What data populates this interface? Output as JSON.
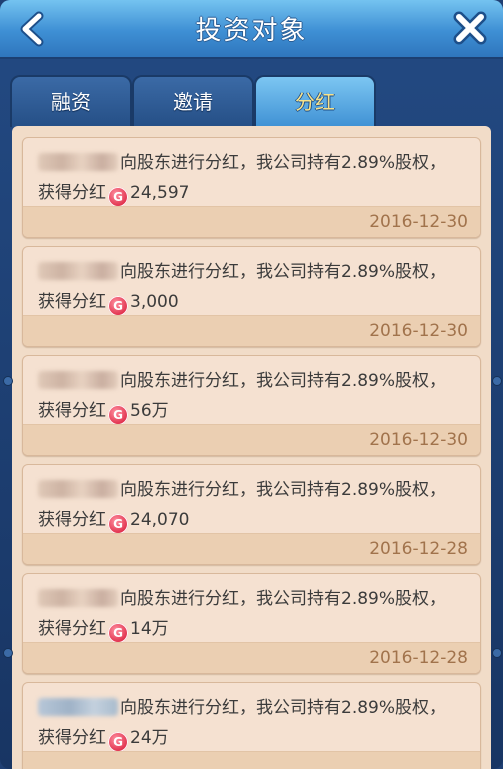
{
  "header": {
    "title": "投资对象",
    "back_icon": "chevron-left-icon",
    "close_icon": "close-icon"
  },
  "tabs": [
    {
      "label": "融资",
      "active": false
    },
    {
      "label": "邀请",
      "active": false
    },
    {
      "label": "分红",
      "active": true
    }
  ],
  "dividends": [
    {
      "message": "向股东进行分红，我公司持有2.89%股权，",
      "gain_label": "获得分红",
      "amount": "24,597",
      "date": "2016-12-30"
    },
    {
      "message": "向股东进行分红，我公司持有2.89%股权，",
      "gain_label": "获得分红",
      "amount": "3,000",
      "date": "2016-12-30"
    },
    {
      "message": "向股东进行分红，我公司持有2.89%股权，",
      "gain_label": "获得分红",
      "amount": "56万",
      "date": "2016-12-30"
    },
    {
      "message": "向股东进行分红，我公司持有2.89%股权，",
      "gain_label": "获得分红",
      "amount": "24,070",
      "date": "2016-12-28"
    },
    {
      "message": "向股东进行分红，我公司持有2.89%股权，",
      "gain_label": "获得分红",
      "amount": "14万",
      "date": "2016-12-28"
    },
    {
      "message": "向股东进行分红，我公司持有2.89%股权，",
      "gain_label": "获得分红",
      "amount": "24万",
      "date": ""
    }
  ],
  "coin_icon": "gold-coin-icon",
  "colors": {
    "title_bar": "#3e8fd4",
    "active_tab_text": "#f7e28a",
    "card_bg": "#f5e1d1",
    "date_text": "#a1734c"
  }
}
